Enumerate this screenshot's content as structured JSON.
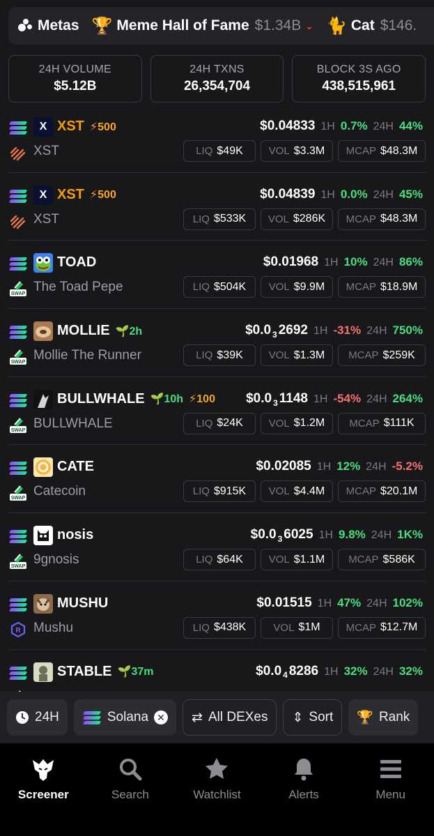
{
  "metas": {
    "label": "Metas",
    "hall_label": "Meme Hall of Fame",
    "hall_value": "$1.34B",
    "cat_label": "Cat",
    "cat_value": "$146."
  },
  "stats": [
    {
      "label": "24H VOLUME",
      "value": "$5.12B"
    },
    {
      "label": "24H TXNS",
      "value": "26,354,704"
    },
    {
      "label": "BLOCK 3S AGO",
      "value": "438,515,961"
    }
  ],
  "labels": {
    "h1": "1H",
    "h24": "24H",
    "liq": "LIQ",
    "vol": "VOL",
    "mcap": "MCAP"
  },
  "tokens": [
    {
      "symbol": "XST",
      "boost": "⚡500",
      "age": "",
      "name": "XST",
      "price_pre": "$0.04833",
      "price_sub": "",
      "price_post": "",
      "h1": "0.7%",
      "h1_dir": "pos",
      "h24": "44%",
      "h24_dir": "pos",
      "liq": "$49K",
      "vol": "$3.3M",
      "mcap": "$48.3M",
      "icon": "xst",
      "dex": "pump"
    },
    {
      "symbol": "XST",
      "boost": "⚡500",
      "age": "",
      "name": "XST",
      "price_pre": "$0.04839",
      "price_sub": "",
      "price_post": "",
      "h1": "0.0%",
      "h1_dir": "pos",
      "h24": "45%",
      "h24_dir": "pos",
      "liq": "$533K",
      "vol": "$286K",
      "mcap": "$48.3M",
      "icon": "xst",
      "dex": "pump"
    },
    {
      "symbol": "TOAD",
      "boost": "",
      "age": "",
      "name": "The Toad Pepe",
      "price_pre": "$0.01968",
      "price_sub": "",
      "price_post": "",
      "h1": "10%",
      "h1_dir": "pos",
      "h24": "86%",
      "h24_dir": "pos",
      "liq": "$504K",
      "vol": "$9.9M",
      "mcap": "$18.9M",
      "icon": "toad",
      "dex": "swap"
    },
    {
      "symbol": "MOLLIE",
      "boost": "",
      "age": "2h",
      "name": "Mollie The Runner",
      "price_pre": "$0.0",
      "price_sub": "3",
      "price_post": "2692",
      "h1": "-31%",
      "h1_dir": "neg",
      "h24": "750%",
      "h24_dir": "pos",
      "liq": "$39K",
      "vol": "$1.3M",
      "mcap": "$259K",
      "icon": "mollie",
      "dex": "swap"
    },
    {
      "symbol": "BULLWHALE",
      "boost": "⚡100",
      "age": "10h",
      "name": "BULLWHALE",
      "price_pre": "$0.0",
      "price_sub": "3",
      "price_post": "1148",
      "h1": "-54%",
      "h1_dir": "neg",
      "h24": "264%",
      "h24_dir": "pos",
      "liq": "$24K",
      "vol": "$1.2M",
      "mcap": "$111K",
      "icon": "bull",
      "dex": "swap"
    },
    {
      "symbol": "CATE",
      "boost": "",
      "age": "",
      "name": "Catecoin",
      "price_pre": "$0.02085",
      "price_sub": "",
      "price_post": "",
      "h1": "12%",
      "h1_dir": "pos",
      "h24": "-5.2%",
      "h24_dir": "neg",
      "liq": "$915K",
      "vol": "$4.4M",
      "mcap": "$20.1M",
      "icon": "cate",
      "dex": "swap"
    },
    {
      "symbol": "nosis",
      "boost": "",
      "age": "",
      "name": "9gnosis",
      "price_pre": "$0.0",
      "price_sub": "3",
      "price_post": "6025",
      "h1": "9.8%",
      "h1_dir": "pos",
      "h24": "1K%",
      "h24_dir": "pos",
      "liq": "$64K",
      "vol": "$1.1M",
      "mcap": "$586K",
      "icon": "nosis",
      "dex": "swap"
    },
    {
      "symbol": "MUSHU",
      "boost": "",
      "age": "",
      "name": "Mushu",
      "price_pre": "$0.01515",
      "price_sub": "",
      "price_post": "",
      "h1": "47%",
      "h1_dir": "pos",
      "h24": "102%",
      "h24_dir": "pos",
      "liq": "$438K",
      "vol": "$1M",
      "mcap": "$12.7M",
      "icon": "mushu",
      "dex": "raydium"
    },
    {
      "symbol": "STABLE",
      "boost": "",
      "age": "37m",
      "name": "",
      "price_pre": "$0.0",
      "price_sub": "4",
      "price_post": "8286",
      "h1": "32%",
      "h1_dir": "pos",
      "h24": "32%",
      "h24_dir": "pos",
      "liq": "",
      "vol": "",
      "mcap": "",
      "icon": "stable",
      "dex": "swap"
    }
  ],
  "filters": {
    "time": "24H",
    "chain": "Solana",
    "dex": "All DEXes",
    "sort": "Sort",
    "rank": "Rank"
  },
  "nav": [
    {
      "label": "Screener",
      "icon": "eagle-icon",
      "active": true
    },
    {
      "label": "Search",
      "icon": "search-icon",
      "active": false
    },
    {
      "label": "Watchlist",
      "icon": "star-icon",
      "active": false
    },
    {
      "label": "Alerts",
      "icon": "bell-icon",
      "active": false
    },
    {
      "label": "Menu",
      "icon": "menu-icon",
      "active": false
    }
  ]
}
